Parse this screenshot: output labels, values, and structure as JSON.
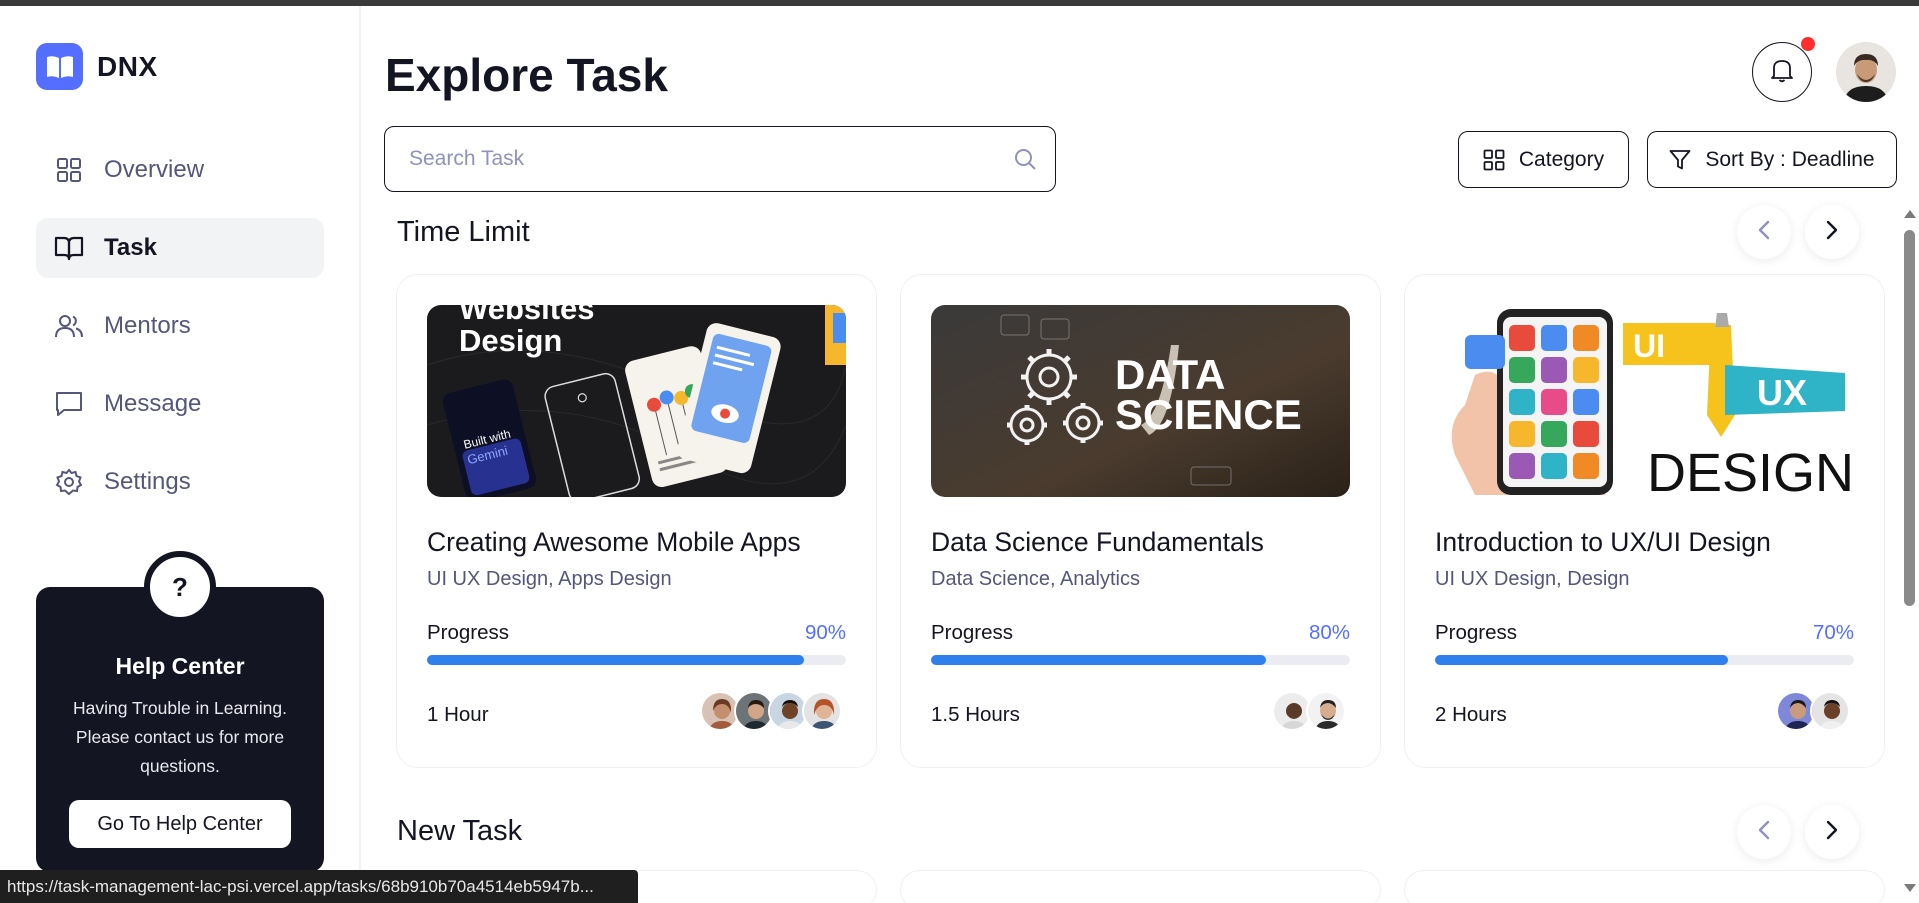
{
  "app": {
    "name": "DNX",
    "status_url": "https://task-management-lac-psi.vercel.app/tasks/68b910b70a4514eb5947b..."
  },
  "sidebar": {
    "items": [
      {
        "label": "Overview",
        "icon": "grid-icon",
        "active": false
      },
      {
        "label": "Task",
        "icon": "book-icon",
        "active": true
      },
      {
        "label": "Mentors",
        "icon": "users-icon",
        "active": false
      },
      {
        "label": "Message",
        "icon": "message-icon",
        "active": false
      },
      {
        "label": "Settings",
        "icon": "gear-icon",
        "active": false
      }
    ],
    "help": {
      "badge": "?",
      "title": "Help Center",
      "text": "Having Trouble in Learning. Please contact us for more questions.",
      "button": "Go To Help Center"
    }
  },
  "header": {
    "title": "Explore Task",
    "notification_dot": true
  },
  "search": {
    "placeholder": "Search Task",
    "value": ""
  },
  "filters": {
    "category_label": "Category",
    "sort_label": "Sort By : Deadline"
  },
  "sections": [
    {
      "title": "Time Limit",
      "cards": [
        {
          "title": "Creating Awesome Mobile Apps",
          "subtitle": "UI UX Design, Apps Design",
          "progress_label": "Progress",
          "progress_text": "90%",
          "progress": 0.9,
          "duration": "1 Hour",
          "avatars": 4,
          "thumb": {
            "heading_line1": "Websites",
            "heading_line2": "Design",
            "phone_text1": "Built with",
            "phone_text2": "Gemini"
          }
        },
        {
          "title": "Data Science Fundamentals",
          "subtitle": "Data Science, Analytics",
          "progress_label": "Progress",
          "progress_text": "80%",
          "progress": 0.8,
          "duration": "1.5 Hours",
          "avatars": 2,
          "thumb": {
            "heading_line1": "DATA",
            "heading_line2": "SCIENCE"
          }
        },
        {
          "title": "Introduction to UX/UI Design",
          "subtitle": "UI UX Design, Design",
          "progress_label": "Progress",
          "progress_text": "70%",
          "progress": 0.7,
          "duration": "2 Hours",
          "avatars": 2,
          "thumb": {
            "tag_ui": "UI",
            "tag_ux": "UX",
            "heading": "DESIGN"
          }
        }
      ]
    },
    {
      "title": "New Task",
      "cards": []
    }
  ],
  "colors": {
    "accent": "#546fff",
    "progress": "#2f80ed",
    "dark": "#141522",
    "muted": "#54577a",
    "notification": "#ff2d2d"
  }
}
